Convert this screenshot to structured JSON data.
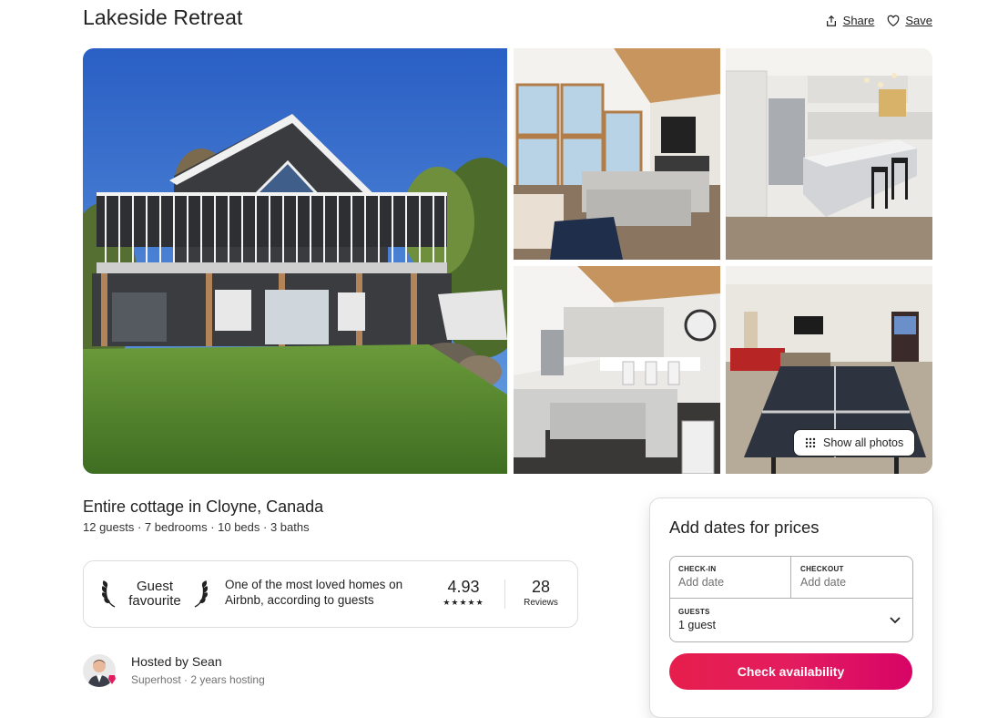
{
  "listing": {
    "title": "Lakeside Retreat",
    "share_label": "Share",
    "save_label": "Save",
    "show_all_photos": "Show all photos",
    "subtitle": "Entire cottage in Cloyne, Canada",
    "facts": "12 guests · 7 bedrooms · 10 beds · 3 baths"
  },
  "guest_favourite": {
    "badge_line1": "Guest",
    "badge_line2": "favourite",
    "description": "One of the most loved homes on Airbnb, according to guests",
    "rating": "4.93",
    "stars": "★★★★★",
    "reviews_count": "28",
    "reviews_label": "Reviews"
  },
  "host": {
    "name": "Hosted by Sean",
    "meta": "Superhost · 2 years hosting"
  },
  "booking": {
    "heading": "Add dates for prices",
    "checkin_label": "CHECK-IN",
    "checkin_value": "Add date",
    "checkout_label": "CHECKOUT",
    "checkout_value": "Add date",
    "guests_label": "GUESTS",
    "guests_value": "1 guest",
    "cta": "Check availability"
  },
  "colors": {
    "brand": "#e31c5f",
    "text": "#222222",
    "muted": "#717171",
    "border": "#dddddd"
  },
  "icons": [
    "share-icon",
    "heart-icon",
    "grid-icon",
    "laurel-icon",
    "chevron-down-icon",
    "superhost-icon"
  ]
}
